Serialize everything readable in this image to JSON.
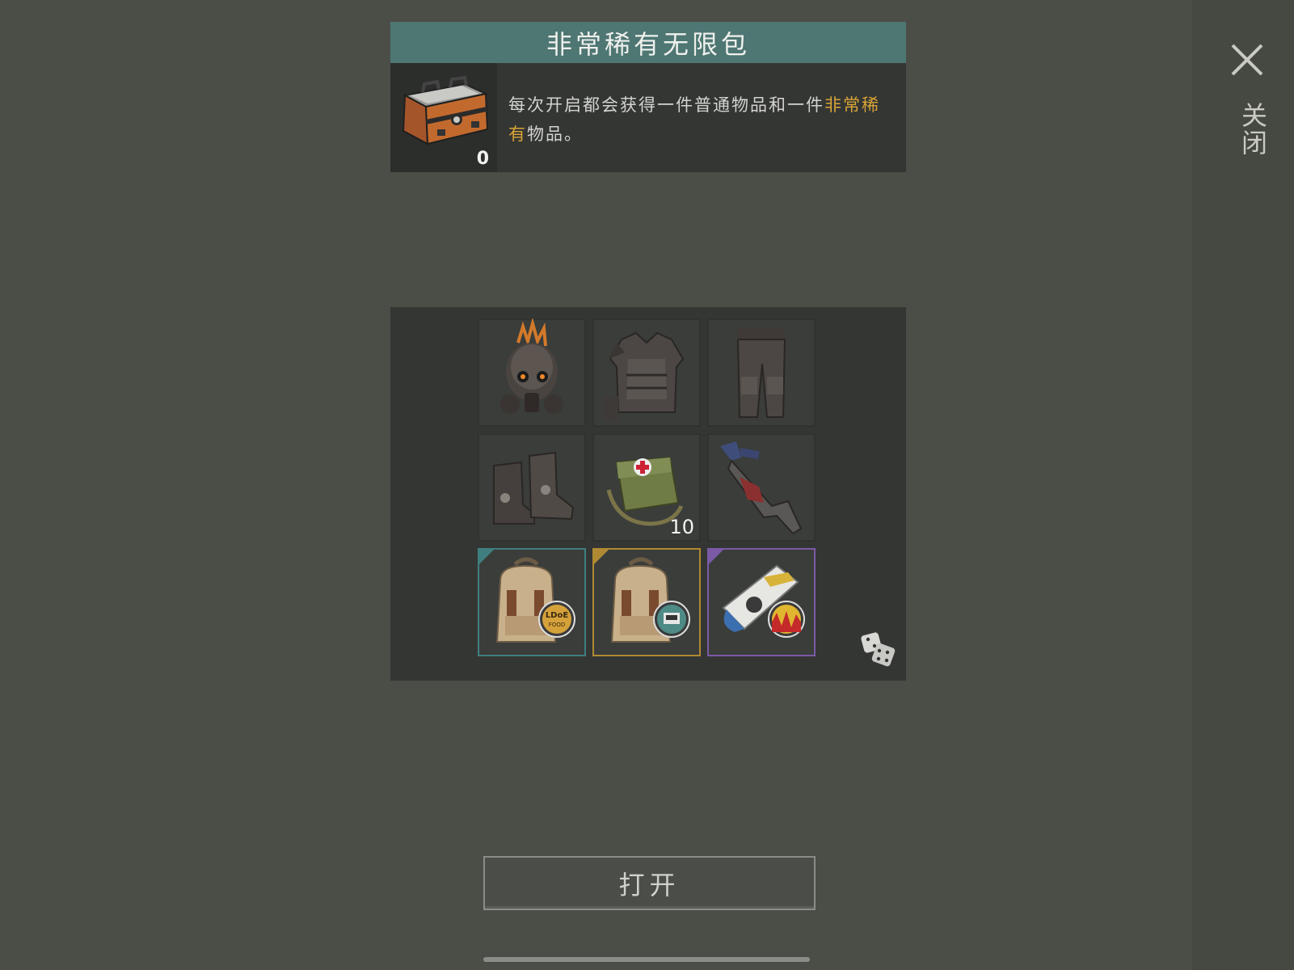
{
  "pack": {
    "title": "非常稀有无限包",
    "count": "0",
    "icon": "supply-crate-icon",
    "description_part1": "每次开启都会获得一件普通物品和一件",
    "description_highlight": "非常稀有",
    "description_part2": "物品。"
  },
  "close": {
    "label": "关闭",
    "icon": "close-icon"
  },
  "items": [
    {
      "name": "spiked-gas-mask-helmet",
      "icon": "helmet-icon",
      "qty": ""
    },
    {
      "name": "armored-chest-plate",
      "icon": "armor-vest-icon",
      "qty": ""
    },
    {
      "name": "armored-pants",
      "icon": "pants-icon",
      "qty": ""
    },
    {
      "name": "skull-boots",
      "icon": "boots-icon",
      "qty": ""
    },
    {
      "name": "medical-bag",
      "icon": "first-aid-bag-icon",
      "qty": "10"
    },
    {
      "name": "chainsaw-weapon",
      "icon": "weapon-icon",
      "qty": ""
    },
    {
      "name": "food-backpack",
      "icon": "backpack-food-icon",
      "qty": "",
      "badge": "LDoE FOOD",
      "rarity": "teal"
    },
    {
      "name": "tech-backpack",
      "icon": "backpack-tech-icon",
      "qty": "",
      "rarity": "gold"
    },
    {
      "name": "magazine-roll",
      "icon": "magazine-icon",
      "qty": "",
      "rarity": "purple"
    }
  ],
  "dice": {
    "icon": "dice-icon"
  },
  "open_button": {
    "label": "打开"
  },
  "colors": {
    "background": "#4b4e47",
    "header": "#4e7673",
    "highlight": "#d8a437",
    "rarity_teal": "#3f7e7f",
    "rarity_gold": "#b08a33",
    "rarity_purple": "#7b5aa6"
  }
}
